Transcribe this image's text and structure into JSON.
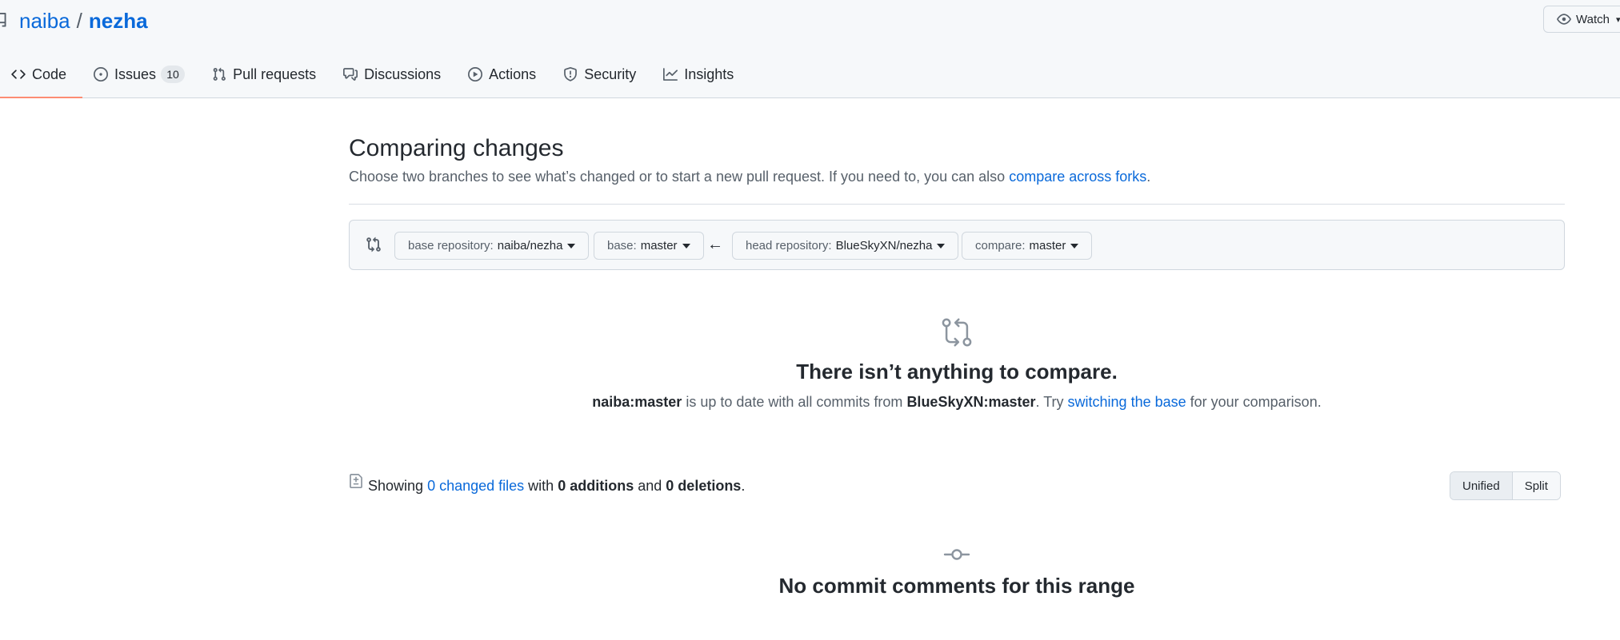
{
  "repo": {
    "owner": "naiba",
    "separator": "/",
    "name": "nezha",
    "watch_label": "Watch"
  },
  "tabs": [
    {
      "label": "Code",
      "icon": "code-icon",
      "selected": true
    },
    {
      "label": "Issues",
      "icon": "issue-opened-icon",
      "counter": "10"
    },
    {
      "label": "Pull requests",
      "icon": "git-pull-request-icon"
    },
    {
      "label": "Discussions",
      "icon": "comment-discussion-icon"
    },
    {
      "label": "Actions",
      "icon": "play-icon"
    },
    {
      "label": "Security",
      "icon": "shield-icon"
    },
    {
      "label": "Insights",
      "icon": "graph-icon"
    }
  ],
  "compare": {
    "title": "Comparing changes",
    "subtitle": "Choose two branches to see what’s changed or to start a new pull request. If you need to, you can also",
    "subtitle_link": "compare across forks",
    "subtitle_end": ".",
    "base_repo_label": "base repository:",
    "base_repo_value": "naiba/nezha",
    "base_label": "base:",
    "base_value": "master",
    "head_repo_label": "head repository:",
    "head_repo_value": "BlueSkyXN/nezha",
    "compare_label": "compare:",
    "compare_value": "master"
  },
  "blank_slate": {
    "title": "There isn’t anything to compare.",
    "base_ref": "naiba:master",
    "text_mid": "is up to date with all commits from",
    "head_ref": "BlueSkyXN:master",
    "text_try": ". Try",
    "link": "switching the base",
    "text_end": "for your comparison."
  },
  "toc": {
    "showing": "Showing",
    "changed_files": "0 changed files",
    "with": "with",
    "additions": "0 additions",
    "and": "and",
    "deletions": "0 deletions",
    "period": ".",
    "unified": "Unified",
    "split": "Split"
  },
  "comments": {
    "title": "No commit comments for this range"
  },
  "colors": {
    "link": "#0969da",
    "tab_underline": "#fd8c73",
    "text": "#24292f",
    "muted": "#57606a"
  }
}
